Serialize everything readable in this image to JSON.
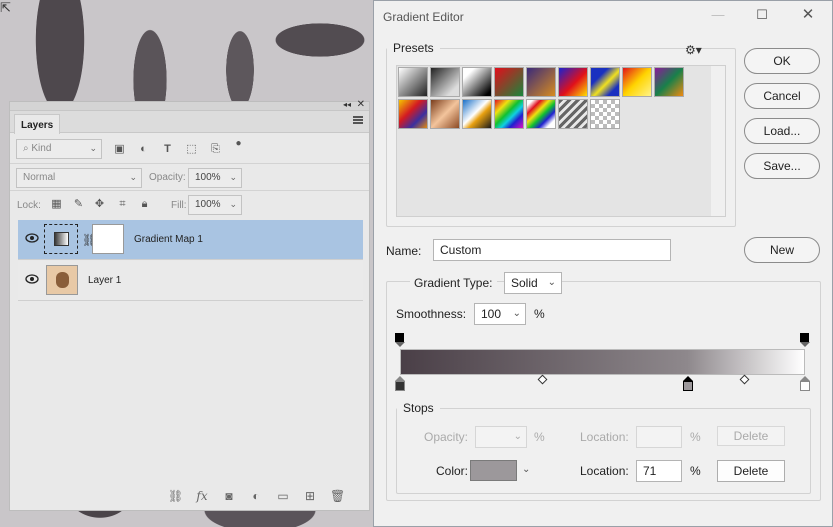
{
  "layers_panel": {
    "tab_label": "Layers",
    "filter_placeholder": "Kind",
    "blend_mode": "Normal",
    "opacity_label": "Opacity:",
    "opacity_value": "100%",
    "lock_label": "Lock:",
    "fill_label": "Fill:",
    "fill_value": "100%",
    "layers": [
      {
        "name": "Gradient Map 1",
        "selected": true
      },
      {
        "name": "Layer 1",
        "selected": false
      }
    ]
  },
  "gradient_editor": {
    "title": "Gradient Editor",
    "presets_legend": "Presets",
    "ok_label": "OK",
    "cancel_label": "Cancel",
    "load_label": "Load...",
    "save_label": "Save...",
    "name_label": "Name:",
    "name_value": "Custom",
    "new_label": "New",
    "gradient_type_label": "Gradient Type:",
    "gradient_type_value": "Solid",
    "smoothness_label": "Smoothness:",
    "smoothness_value": "100",
    "smoothness_unit": "%",
    "stops_legend": "Stops",
    "opacity_label": "Opacity:",
    "opacity_unit": "%",
    "location_label": "Location:",
    "location_unit": "%",
    "delete_label": "Delete",
    "color_label": "Color:",
    "color_value": "#9c989b",
    "color_location_value": "71",
    "color_location_unit": "%",
    "gradient_colors": [
      "#4a3f47",
      "#8e888c",
      "#ffffff"
    ],
    "color_stop_locations": [
      0,
      71,
      100
    ],
    "opacity_stop_locations": [
      0,
      100
    ],
    "midpoint_locations": [
      35,
      85
    ]
  }
}
